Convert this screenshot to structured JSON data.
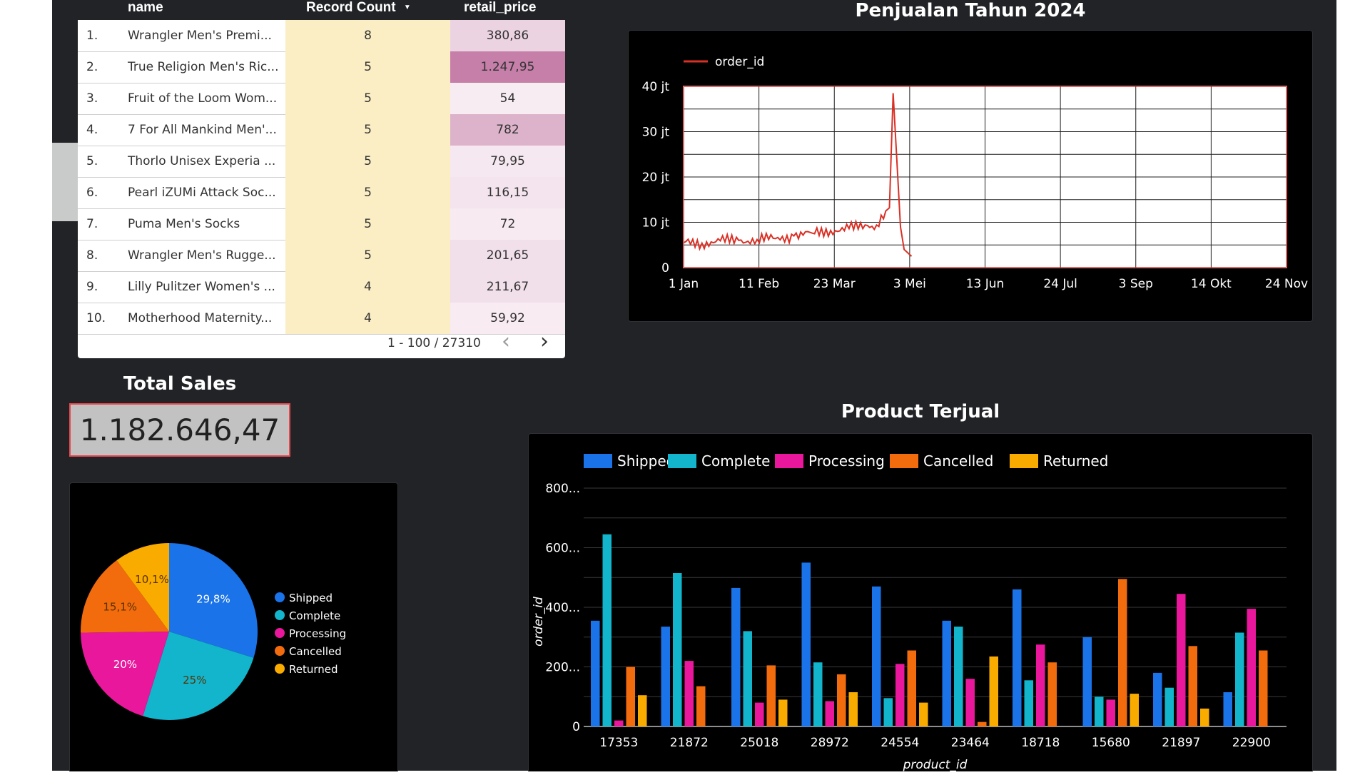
{
  "table": {
    "columns": [
      "name",
      "Record Count",
      "retail_price"
    ],
    "sort_indicator": "▼",
    "rows": [
      {
        "idx": "1.",
        "name": "Wrangler Men's Premi...",
        "count": "8",
        "price": "380,86",
        "shade": "#ecd3e1"
      },
      {
        "idx": "2.",
        "name": "True Religion Men's Ric...",
        "count": "5",
        "price": "1.247,95",
        "shade": "#c57fa9"
      },
      {
        "idx": "3.",
        "name": "Fruit of the Loom Wom...",
        "count": "5",
        "price": "54",
        "shade": "#f8ecf3"
      },
      {
        "idx": "4.",
        "name": "7 For All Mankind Men'...",
        "count": "5",
        "price": "782",
        "shade": "#dcb3ca"
      },
      {
        "idx": "5.",
        "name": "Thorlo Unisex Experia ...",
        "count": "5",
        "price": "79,95",
        "shade": "#f6e8f0"
      },
      {
        "idx": "6.",
        "name": "Pearl iZUMi Attack Soc...",
        "count": "5",
        "price": "116,15",
        "shade": "#f4e4ed"
      },
      {
        "idx": "7.",
        "name": "Puma Men's Socks",
        "count": "5",
        "price": "72",
        "shade": "#f7eaf1"
      },
      {
        "idx": "8.",
        "name": "Wrangler Men's Rugge...",
        "count": "5",
        "price": "201,65",
        "shade": "#f1dfe9"
      },
      {
        "idx": "9.",
        "name": "Lilly Pulitzer Women's ...",
        "count": "4",
        "price": "211,67",
        "shade": "#f1dfe9"
      },
      {
        "idx": "10.",
        "name": "Motherhood Maternity...",
        "count": "4",
        "price": "59,92",
        "shade": "#f8ebf2"
      }
    ],
    "pagination": "1 - 100 / 27310",
    "prev_icon": "‹",
    "next_icon": "›"
  },
  "total_sales": {
    "title": "Total Sales",
    "value": "1.182.646,47"
  },
  "colors": {
    "Shipped": "#1a73e8",
    "Complete": "#12b5cb",
    "Processing": "#e8179b",
    "Cancelled": "#f26c0d",
    "Returned": "#f9ab00",
    "line": "#d93025"
  },
  "chart_data": [
    {
      "type": "line",
      "title": "Penjualan Tahun 2024",
      "legend": [
        "order_id"
      ],
      "legend_position": "top-left",
      "x_ticks": [
        "1 Jan",
        "11 Feb",
        "23 Mar",
        "3 Mei",
        "13 Jun",
        "24 Jul",
        "3 Sep",
        "14 Okt",
        "24 Nov"
      ],
      "y_ticks": [
        "0",
        "10 jt",
        "20 jt",
        "30 jt",
        "40 jt"
      ],
      "ylim": [
        0,
        40000000
      ],
      "grid": true,
      "series": [
        {
          "name": "order_id",
          "x_day": [
            0,
            10,
            20,
            30,
            40,
            50,
            60,
            70,
            80,
            90,
            100,
            105,
            110,
            112,
            114,
            116,
            118,
            120,
            124
          ],
          "values": [
            5500000,
            5400000,
            5900000,
            6000000,
            6200000,
            6400000,
            7000000,
            7600000,
            8200000,
            8600000,
            9300000,
            9400000,
            12500000,
            13200000,
            38500000,
            24000000,
            9000000,
            4000000,
            2500000
          ]
        }
      ]
    },
    {
      "type": "pie",
      "legend_position": "right",
      "labels": [
        "Shipped",
        "Complete",
        "Processing",
        "Cancelled",
        "Returned"
      ],
      "values": [
        29.8,
        25,
        20,
        15.1,
        10.1
      ],
      "display": [
        "29,8%",
        "25%",
        "20%",
        "15,1%",
        "10,1%"
      ]
    },
    {
      "type": "bar",
      "title": "Product Terjual",
      "xlabel": "product_id",
      "ylabel": "order_id",
      "legend_position": "top",
      "y_ticks": [
        "0",
        "200...",
        "400...",
        "600...",
        "800..."
      ],
      "ylim": [
        0,
        800
      ],
      "grid": true,
      "categories": [
        "17353",
        "21872",
        "25018",
        "28972",
        "24554",
        "23464",
        "18718",
        "15680",
        "21897",
        "22900"
      ],
      "series": [
        {
          "name": "Shipped",
          "values": [
            355,
            335,
            465,
            550,
            470,
            355,
            460,
            300,
            180,
            115
          ]
        },
        {
          "name": "Complete",
          "values": [
            645,
            515,
            320,
            215,
            95,
            335,
            155,
            100,
            130,
            315
          ]
        },
        {
          "name": "Processing",
          "values": [
            20,
            220,
            80,
            85,
            210,
            160,
            275,
            90,
            445,
            395
          ]
        },
        {
          "name": "Cancelled",
          "values": [
            200,
            135,
            205,
            175,
            255,
            15,
            215,
            495,
            270,
            255
          ]
        },
        {
          "name": "Returned",
          "values": [
            105,
            0,
            90,
            115,
            80,
            235,
            0,
            110,
            60,
            0
          ]
        }
      ]
    }
  ]
}
